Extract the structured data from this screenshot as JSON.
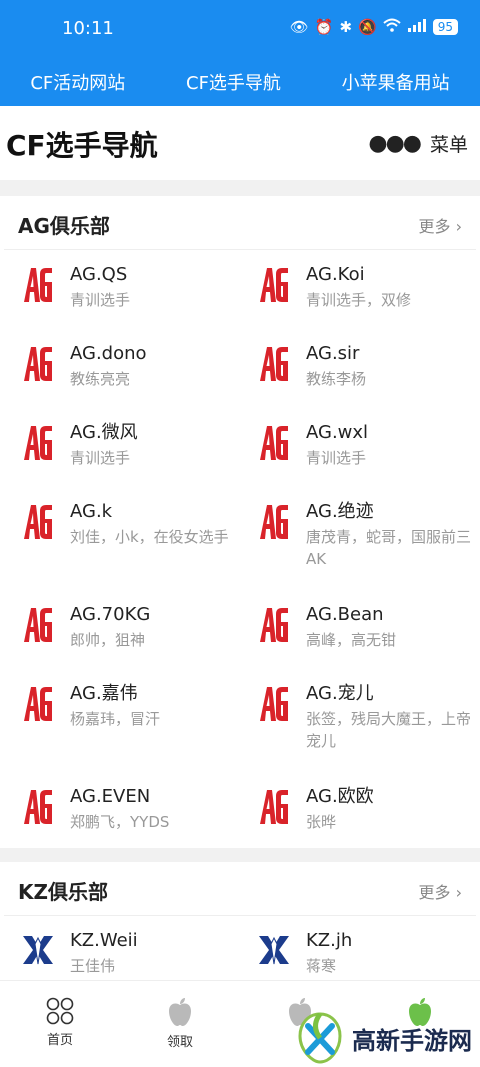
{
  "status": {
    "time": "10:11",
    "battery": "95",
    "signal": "5G"
  },
  "topnav": [
    "CF活动网站",
    "CF选手导航",
    "小苹果备用站"
  ],
  "header": {
    "title": "CF选手导航",
    "menu_label": "菜单"
  },
  "sections": [
    {
      "title": "AG俱乐部",
      "more": "更多",
      "logo": "ag-logo",
      "players": [
        {
          "name": "AG.QS",
          "desc": "青训选手"
        },
        {
          "name": "AG.Koi",
          "desc": "青训选手，双修"
        },
        {
          "name": "AG.dono",
          "desc": "教练亮亮"
        },
        {
          "name": "AG.sir",
          "desc": "教练李杨"
        },
        {
          "name": "AG.微风",
          "desc": "青训选手"
        },
        {
          "name": "AG.wxl",
          "desc": "青训选手"
        },
        {
          "name": "AG.k",
          "desc": "刘佳，小k，在役女选手"
        },
        {
          "name": "AG.绝迹",
          "desc": "唐茂青，蛇哥，国服前三AK"
        },
        {
          "name": "AG.70KG",
          "desc": "郎帅，狙神"
        },
        {
          "name": "AG.Bean",
          "desc": "高峰，高无钳"
        },
        {
          "name": "AG.嘉伟",
          "desc": "杨嘉玮，冒汗"
        },
        {
          "name": "AG.宠儿",
          "desc": "张签，残局大魔王，上帝宠儿"
        },
        {
          "name": "AG.EVEN",
          "desc": "郑鹏飞，YYDS"
        },
        {
          "name": "AG.欧欧",
          "desc": "张晔"
        }
      ]
    },
    {
      "title": "KZ俱乐部",
      "more": "更多",
      "logo": "kz-logo",
      "players": [
        {
          "name": "KZ.Weii",
          "desc": "王佳伟"
        },
        {
          "name": "KZ.jh",
          "desc": "蒋寒"
        }
      ]
    }
  ],
  "bottomnav": [
    {
      "label": "首页",
      "icon": "grid-icon"
    },
    {
      "label": "领取",
      "icon": "apple-icon"
    },
    {
      "label": "",
      "icon": "apple-icon"
    },
    {
      "label": "",
      "icon": "apple-green-icon"
    }
  ],
  "watermark": {
    "text": "高新手游网"
  },
  "colors": {
    "accent": "#1a8cf0",
    "ag_red": "#d9232a",
    "kz_blue": "#1c3c8c"
  }
}
